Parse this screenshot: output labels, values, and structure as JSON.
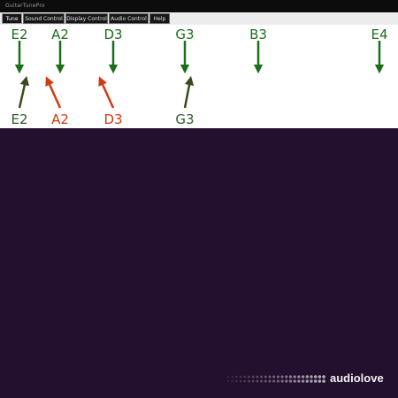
{
  "window": {
    "title": "GuitarTunePro"
  },
  "tabs": [
    {
      "label": "Tune",
      "active": true
    },
    {
      "label": "Sound Control",
      "active": false
    },
    {
      "label": "Display Control",
      "active": false
    },
    {
      "label": "Audio Control",
      "active": false
    },
    {
      "label": "Help",
      "active": false
    }
  ],
  "target_notes": [
    "E2",
    "A2",
    "D3",
    "G3",
    "B3",
    "E4"
  ],
  "detected_notes": [
    "E2",
    "A2",
    "D3",
    "G3"
  ],
  "colors": {
    "target_arrow": "#1b6e1b",
    "target_text": "#1b6e1b",
    "in_tune_arrow": "#3b4a1c",
    "in_tune_text": "#2e5a2e",
    "out_of_tune": "#d23a10",
    "visualizer_bg": "#23102e"
  },
  "watermark": {
    "text": "audiolove"
  }
}
